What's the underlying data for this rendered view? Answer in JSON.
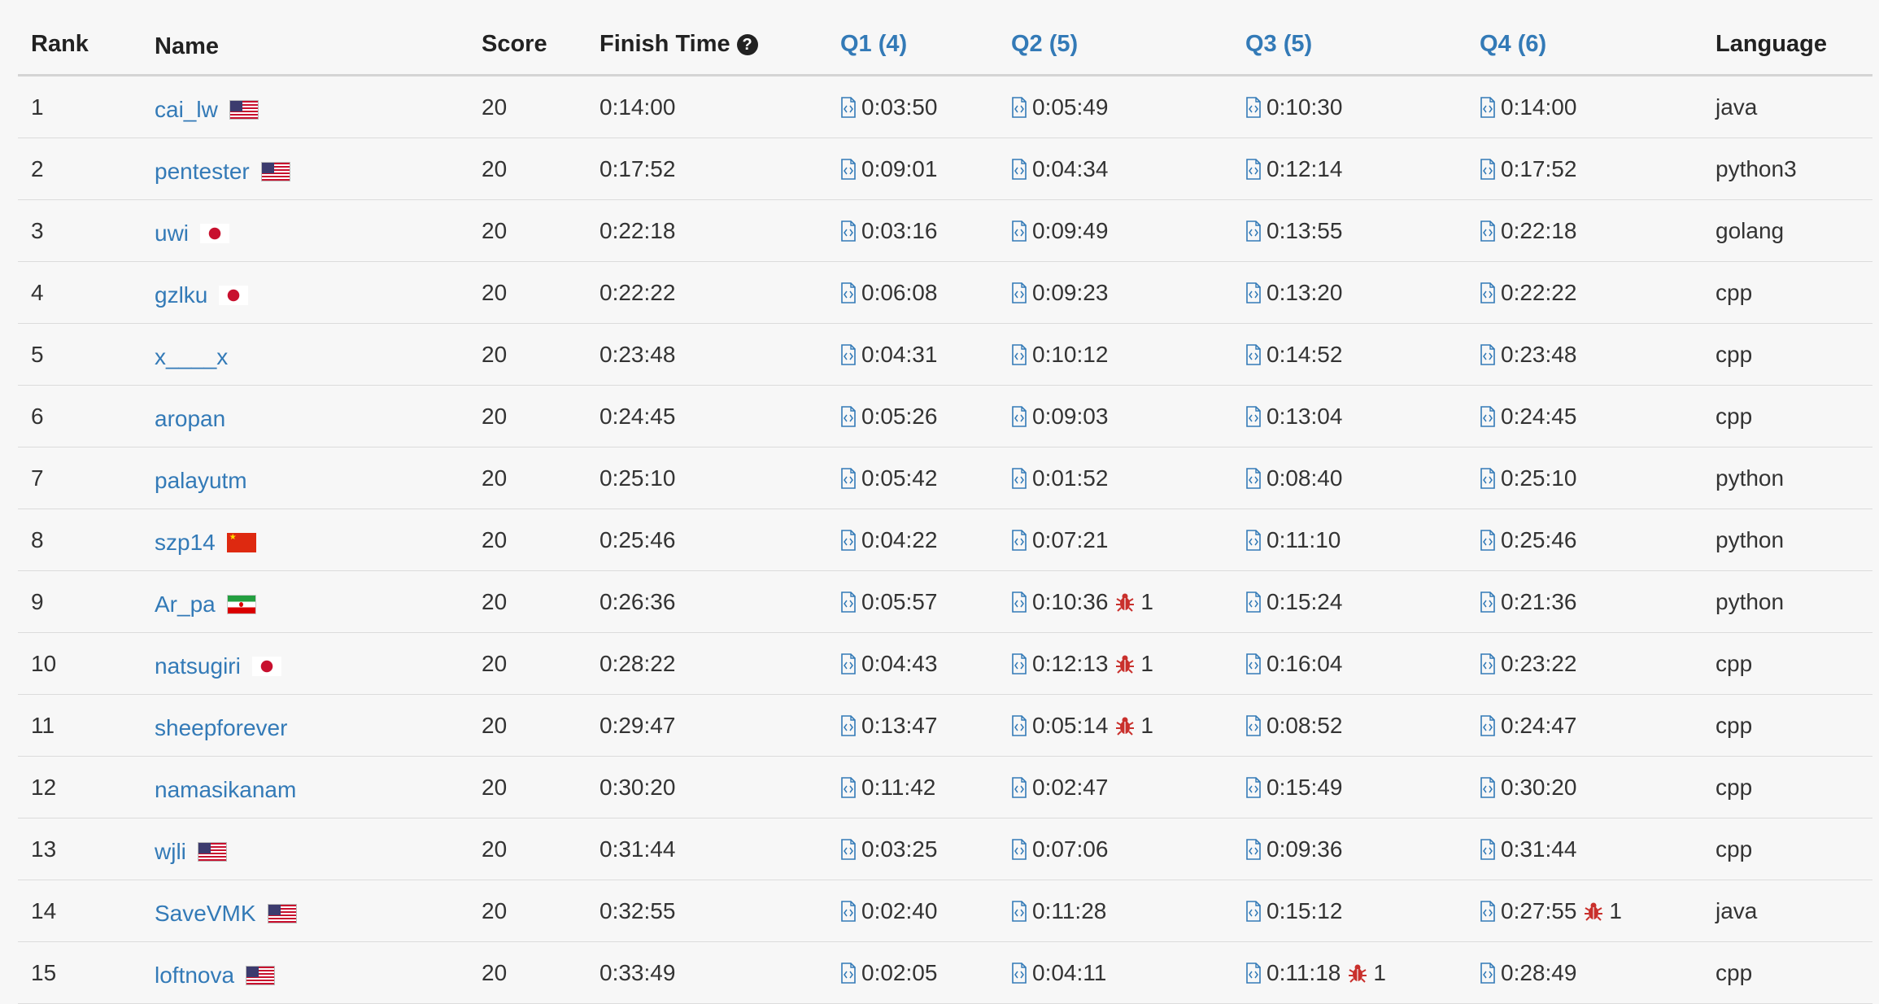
{
  "columns": {
    "rank": "Rank",
    "name": "Name",
    "score": "Score",
    "finish": "Finish Time",
    "q1": "Q1 (4)",
    "q2": "Q2 (5)",
    "q3": "Q3 (5)",
    "q4": "Q4 (6)",
    "language": "Language"
  },
  "help_icon": "?",
  "colors": {
    "link": "#337ab7",
    "bug": "#c9302c",
    "background": "#f7f7f7"
  },
  "icons": {
    "submission": "code-file-icon",
    "wrong_attempt": "bug-icon",
    "help": "question-circle-icon"
  },
  "rows": [
    {
      "rank": "1",
      "name": "cai_lw",
      "flag": "us",
      "score": "20",
      "finish": "0:14:00",
      "q1": "0:03:50",
      "q1_bugs": "",
      "q2": "0:05:49",
      "q2_bugs": "",
      "q3": "0:10:30",
      "q3_bugs": "",
      "q4": "0:14:00",
      "q4_bugs": "",
      "lang": "java"
    },
    {
      "rank": "2",
      "name": "pentester",
      "flag": "us",
      "score": "20",
      "finish": "0:17:52",
      "q1": "0:09:01",
      "q1_bugs": "",
      "q2": "0:04:34",
      "q2_bugs": "",
      "q3": "0:12:14",
      "q3_bugs": "",
      "q4": "0:17:52",
      "q4_bugs": "",
      "lang": "python3"
    },
    {
      "rank": "3",
      "name": "uwi",
      "flag": "jp",
      "score": "20",
      "finish": "0:22:18",
      "q1": "0:03:16",
      "q1_bugs": "",
      "q2": "0:09:49",
      "q2_bugs": "",
      "q3": "0:13:55",
      "q3_bugs": "",
      "q4": "0:22:18",
      "q4_bugs": "",
      "lang": "golang"
    },
    {
      "rank": "4",
      "name": "gzlku",
      "flag": "jp",
      "score": "20",
      "finish": "0:22:22",
      "q1": "0:06:08",
      "q1_bugs": "",
      "q2": "0:09:23",
      "q2_bugs": "",
      "q3": "0:13:20",
      "q3_bugs": "",
      "q4": "0:22:22",
      "q4_bugs": "",
      "lang": "cpp"
    },
    {
      "rank": "5",
      "name": "x____x",
      "flag": "",
      "score": "20",
      "finish": "0:23:48",
      "q1": "0:04:31",
      "q1_bugs": "",
      "q2": "0:10:12",
      "q2_bugs": "",
      "q3": "0:14:52",
      "q3_bugs": "",
      "q4": "0:23:48",
      "q4_bugs": "",
      "lang": "cpp"
    },
    {
      "rank": "6",
      "name": "aropan",
      "flag": "",
      "score": "20",
      "finish": "0:24:45",
      "q1": "0:05:26",
      "q1_bugs": "",
      "q2": "0:09:03",
      "q2_bugs": "",
      "q3": "0:13:04",
      "q3_bugs": "",
      "q4": "0:24:45",
      "q4_bugs": "",
      "lang": "cpp"
    },
    {
      "rank": "7",
      "name": "palayutm",
      "flag": "",
      "score": "20",
      "finish": "0:25:10",
      "q1": "0:05:42",
      "q1_bugs": "",
      "q2": "0:01:52",
      "q2_bugs": "",
      "q3": "0:08:40",
      "q3_bugs": "",
      "q4": "0:25:10",
      "q4_bugs": "",
      "lang": "python"
    },
    {
      "rank": "8",
      "name": "szp14",
      "flag": "cn",
      "score": "20",
      "finish": "0:25:46",
      "q1": "0:04:22",
      "q1_bugs": "",
      "q2": "0:07:21",
      "q2_bugs": "",
      "q3": "0:11:10",
      "q3_bugs": "",
      "q4": "0:25:46",
      "q4_bugs": "",
      "lang": "python"
    },
    {
      "rank": "9",
      "name": "Ar_pa",
      "flag": "ir",
      "score": "20",
      "finish": "0:26:36",
      "q1": "0:05:57",
      "q1_bugs": "",
      "q2": "0:10:36",
      "q2_bugs": "1",
      "q3": "0:15:24",
      "q3_bugs": "",
      "q4": "0:21:36",
      "q4_bugs": "",
      "lang": "python"
    },
    {
      "rank": "10",
      "name": "natsugiri",
      "flag": "jp",
      "score": "20",
      "finish": "0:28:22",
      "q1": "0:04:43",
      "q1_bugs": "",
      "q2": "0:12:13",
      "q2_bugs": "1",
      "q3": "0:16:04",
      "q3_bugs": "",
      "q4": "0:23:22",
      "q4_bugs": "",
      "lang": "cpp"
    },
    {
      "rank": "11",
      "name": "sheepforever",
      "flag": "",
      "score": "20",
      "finish": "0:29:47",
      "q1": "0:13:47",
      "q1_bugs": "",
      "q2": "0:05:14",
      "q2_bugs": "1",
      "q3": "0:08:52",
      "q3_bugs": "",
      "q4": "0:24:47",
      "q4_bugs": "",
      "lang": "cpp"
    },
    {
      "rank": "12",
      "name": "namasikanam",
      "flag": "",
      "score": "20",
      "finish": "0:30:20",
      "q1": "0:11:42",
      "q1_bugs": "",
      "q2": "0:02:47",
      "q2_bugs": "",
      "q3": "0:15:49",
      "q3_bugs": "",
      "q4": "0:30:20",
      "q4_bugs": "",
      "lang": "cpp"
    },
    {
      "rank": "13",
      "name": "wjli",
      "flag": "us",
      "score": "20",
      "finish": "0:31:44",
      "q1": "0:03:25",
      "q1_bugs": "",
      "q2": "0:07:06",
      "q2_bugs": "",
      "q3": "0:09:36",
      "q3_bugs": "",
      "q4": "0:31:44",
      "q4_bugs": "",
      "lang": "cpp"
    },
    {
      "rank": "14",
      "name": "SaveVMK",
      "flag": "us",
      "score": "20",
      "finish": "0:32:55",
      "q1": "0:02:40",
      "q1_bugs": "",
      "q2": "0:11:28",
      "q2_bugs": "",
      "q3": "0:15:12",
      "q3_bugs": "",
      "q4": "0:27:55",
      "q4_bugs": "1",
      "lang": "java"
    },
    {
      "rank": "15",
      "name": "loftnova",
      "flag": "us",
      "score": "20",
      "finish": "0:33:49",
      "q1": "0:02:05",
      "q1_bugs": "",
      "q2": "0:04:11",
      "q2_bugs": "",
      "q3": "0:11:18",
      "q3_bugs": "1",
      "q4": "0:28:49",
      "q4_bugs": "",
      "lang": "cpp"
    }
  ]
}
